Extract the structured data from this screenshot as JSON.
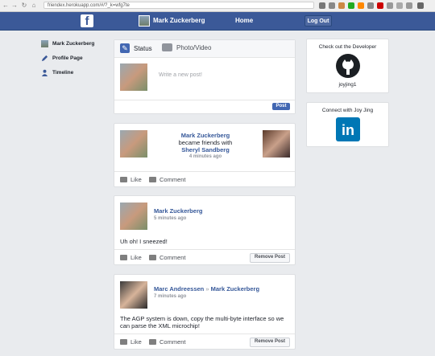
{
  "browser": {
    "url": "friendex.herokuapp.com/#/?_k=wfg7te"
  },
  "topbar": {
    "user_name": "Mark Zuckerberg",
    "home": "Home",
    "logout": "Log Out",
    "brand_color": "#3b5998"
  },
  "sidebar": {
    "items": [
      {
        "label": "Mark Zuckerberg",
        "icon": "avatar"
      },
      {
        "label": "Profile Page",
        "icon": "pencil-icon"
      },
      {
        "label": "Timeline",
        "icon": "person-icon"
      }
    ]
  },
  "composer": {
    "tab_status": "Status",
    "tab_photo": "Photo/Video",
    "placeholder": "Write a new post!",
    "post_button": "Post"
  },
  "friend_story": {
    "name": "Mark Zuckerberg",
    "verb": "became friends with",
    "friend": "Sheryl Sandberg",
    "time": "4 minutes ago",
    "like": "Like",
    "comment": "Comment"
  },
  "post1": {
    "name": "Mark Zuckerberg",
    "time": "5 minutes ago",
    "body": "Uh oh! I sneezed!",
    "like": "Like",
    "comment": "Comment",
    "remove": "Remove Post"
  },
  "post2": {
    "author": "Marc Andreessen",
    "arrow": "»",
    "target": "Mark Zuckerberg",
    "time": "7 minutes ago",
    "body": "The AGP system is down, copy the multi-byte interface so we can parse the XML microchip!",
    "like": "Like",
    "comment": "Comment",
    "remove": "Remove Post"
  },
  "developer": {
    "title": "Check out the Developer",
    "username": "joyjing1"
  },
  "linkedin": {
    "title": "Connect with Joy Jing",
    "logo_text": "in"
  }
}
